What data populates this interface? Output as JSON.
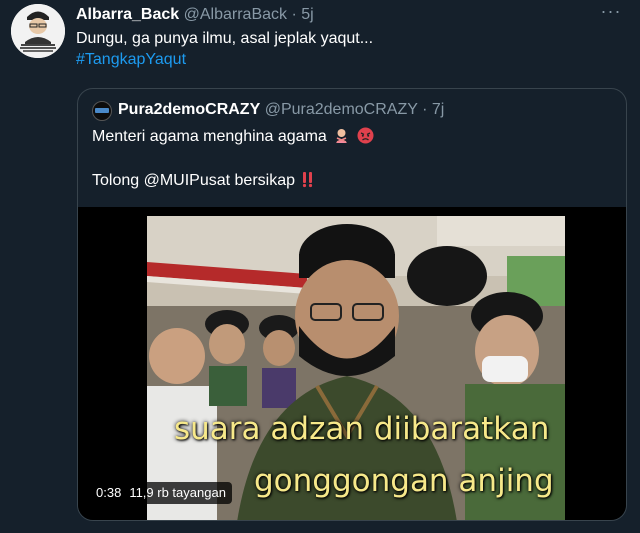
{
  "tweet": {
    "author_name": "Albarra_Back",
    "author_handle": "@AlbarraBack",
    "separator": "·",
    "time": "5j",
    "more_label": "···",
    "text": "Dungu, ga punya ilmu, asal jeplak yaqut...",
    "hashtag": "#TangkapYaqut"
  },
  "quote": {
    "author_name": "Pura2demoCRAZY",
    "author_handle": "@Pura2demoCRAZY",
    "separator": "·",
    "time": "7j",
    "line1": "Menteri agama menghina agama",
    "line2": "Tolong @MUIPusat bersikap"
  },
  "video": {
    "subtitle_line1": "suara adzan diibaratkan",
    "subtitle_line2": "gonggongan anjing",
    "duration": "0:38",
    "views": "11,9 rb tayangan"
  },
  "icons": {
    "avatar": "avatar-portrait-icon",
    "more": "more-options-icon",
    "emoji1": "person-gesturing-no-emoji",
    "emoji2": "angry-face-emoji",
    "emoji3": "double-exclamation-emoji"
  },
  "colors": {
    "background": "#15202b",
    "secondary_text": "#8899a6",
    "link": "#1d9bf0",
    "border": "#38444d",
    "subtitle": "#f7e98a"
  }
}
